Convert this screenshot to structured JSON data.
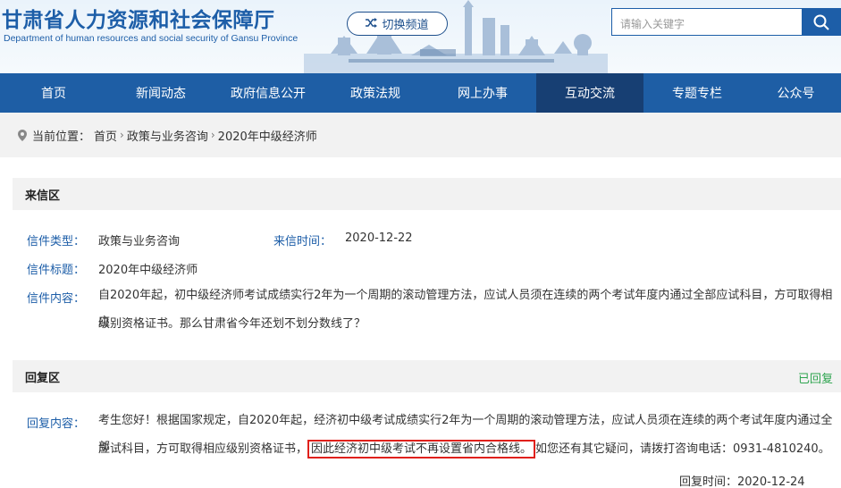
{
  "header": {
    "title": "甘肃省人力资源和社会保障厅",
    "subtitle": "Department of human resources and social security of Gansu Province",
    "switch_label": "切换频道",
    "search_placeholder": "请输入关键字"
  },
  "nav": [
    "首页",
    "新闻动态",
    "政府信息公开",
    "政策法规",
    "网上办事",
    "互动交流",
    "专题专栏",
    "公众号"
  ],
  "breadcrumb": {
    "label": "当前位置：",
    "items": [
      "首页",
      "政策与业务咨询",
      "2020年中级经济师"
    ]
  },
  "letter": {
    "section_title": "来信区",
    "type_label": "信件类型：",
    "type_value": "政策与业务咨询",
    "time_label": "来信时间：",
    "time_value": "2020-12-22",
    "subject_label": "信件标题：",
    "subject_value": "2020年中级经济师",
    "content_label": "信件内容：",
    "content_line1": "自2020年起，初中级经济师考试成绩实行2年为一个周期的滚动管理方法，应试人员须在连续的两个考试年度内通过全部应试科目，方可取得相应",
    "content_line2": "级别资格证书。那么甘肃省今年还划不划分数线了？"
  },
  "reply": {
    "section_title": "回复区",
    "status": "已回复",
    "content_label": "回复内容：",
    "line1": "考生您好！根据国家规定，自2020年起，经济初中级考试成绩实行2年为一个周期的滚动管理方法，应试人员须在连续的两个考试年度内通过全部",
    "line2_a": "应试科目，方可取得相应级别资格证书，",
    "line2_highlight": "因此经济初中级考试不再设置省内合格线。",
    "line2_b": "如您还有其它疑问，请拨打咨询电话：0931-4810240。",
    "time_text": "回复时间：2020-12-24"
  },
  "colors": {
    "brand": "#1e5ea5",
    "nav_active": "#173f73",
    "label": "#1d5ea8",
    "replied": "#2ea44f",
    "highlight_border": "#e0201b"
  }
}
